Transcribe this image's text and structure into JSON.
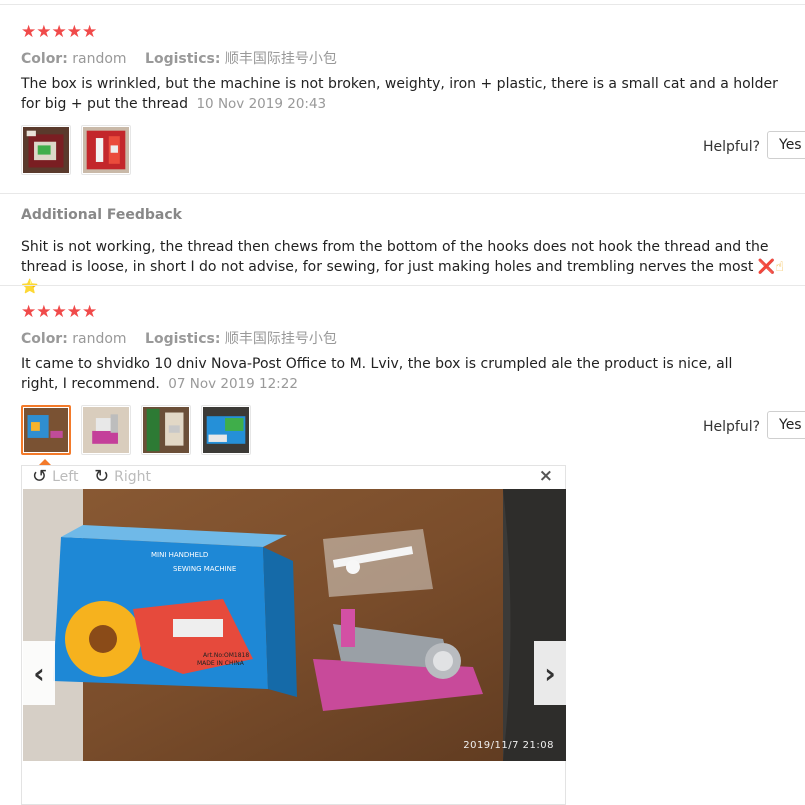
{
  "reviews": [
    {
      "stars": "★★★★★",
      "color_label": "Color:",
      "color_value": "random",
      "logistics_label": "Logistics:",
      "logistics_value": "顺丰国际挂号小包",
      "text": "The box is wrinkled, but the machine is not broken, weighty, iron + plastic, there is a small cat and a holder for big + put the thread",
      "date": "10 Nov 2019 20:43",
      "helpful_label": "Helpful?",
      "yes_label": "Yes",
      "additional_title": "Additional Feedback",
      "additional_text": "Shit is not working, the thread then chews from the bottom of the hooks does not hook the thread and the thread is loose, in short I do not advise, for sewing, for just making holes and trembling nerves the most",
      "additional_emoji": [
        "❌",
        "☝",
        "⭐"
      ]
    },
    {
      "stars": "★★★★★",
      "color_label": "Color:",
      "color_value": "random",
      "logistics_label": "Logistics:",
      "logistics_value": "顺丰国际挂号小包",
      "text": "It came to shvidko 10 dniv Nova-Post Office to M. Lviv, the box is crumpled ale the product is nice, all right, I recommend.",
      "date": "07 Nov 2019 12:22",
      "helpful_label": "Helpful?",
      "yes_label": "Yes"
    }
  ],
  "viewer": {
    "rotate_left_label": "Left",
    "rotate_right_label": "Right",
    "close_symbol": "×",
    "prev_symbol": "‹",
    "next_symbol": "›",
    "photo_timestamp": "2019/11/7  21:08",
    "box_line1": "MINI HANDHELD",
    "box_line2": "SEWING MACHINE",
    "box_art": "Art.No:OM1818",
    "box_made": "MADE IN CHINA"
  },
  "colors": {
    "star": "#f04a4a",
    "muted": "#999999",
    "active_thumb": "#f37a2a"
  }
}
